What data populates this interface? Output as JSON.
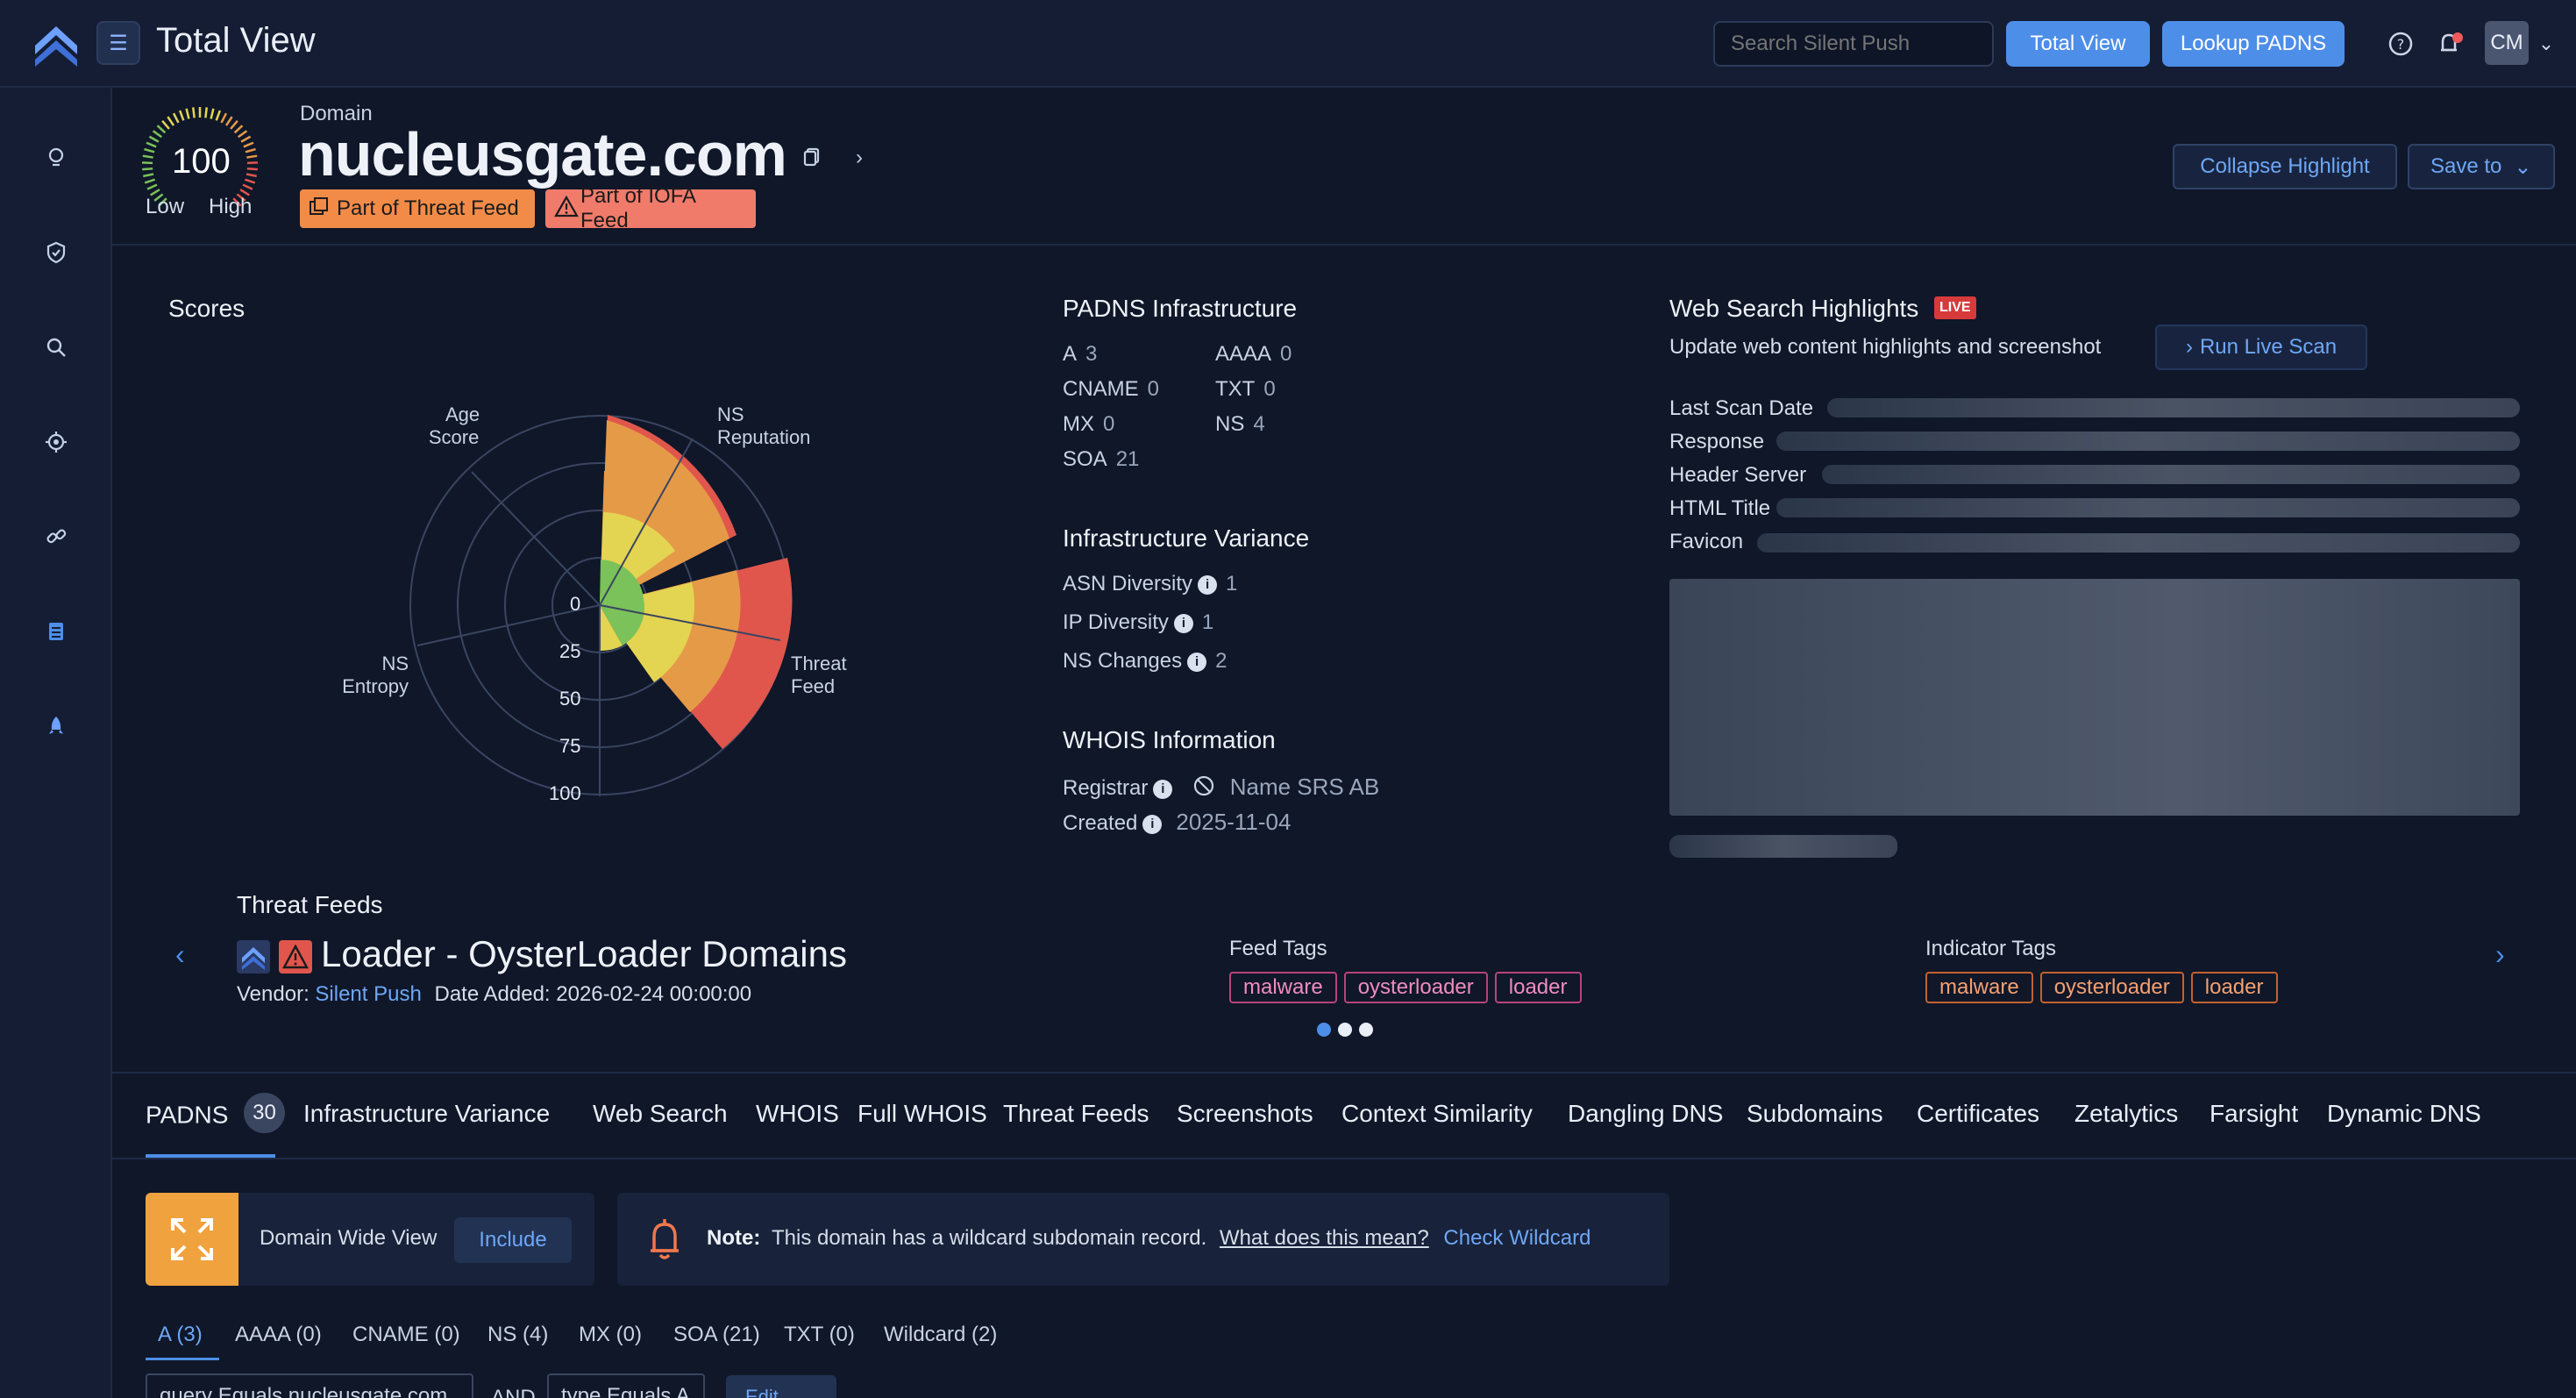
{
  "topbar": {
    "title": "Total View",
    "search_placeholder": "Search Silent Push",
    "total_view_label": "Total View",
    "lookup_label": "Lookup PADNS",
    "avatar_initials": "CM"
  },
  "header": {
    "score": "100",
    "gauge_low": "Low",
    "gauge_high": "High",
    "domain_label": "Domain",
    "domain": "nucleusgate.com",
    "badge_threat_feed": "Part of Threat Feed",
    "badge_iofa": "Part of IOFA Feed",
    "collapse_label": "Collapse Highlight",
    "save_label": "Save to"
  },
  "scores": {
    "title": "Scores",
    "axis_labels": {
      "age_line1": "Age",
      "age_line2": "Score",
      "ns_rep_line1": "NS",
      "ns_rep_line2": "Reputation",
      "ns_ent_line1": "NS",
      "ns_ent_line2": "Entropy",
      "threat_line1": "Threat",
      "threat_line2": "Feed"
    },
    "ticks": [
      "0",
      "25",
      "50",
      "75",
      "100"
    ]
  },
  "padns": {
    "title": "PADNS Infrastructure",
    "a_label": "A",
    "a_value": "3",
    "aaaa_label": "AAAA",
    "aaaa_value": "0",
    "cname_label": "CNAME",
    "cname_value": "0",
    "txt_label": "TXT",
    "txt_value": "0",
    "mx_label": "MX",
    "mx_value": "0",
    "ns_label": "NS",
    "ns_value": "4",
    "soa_label": "SOA",
    "soa_value": "21"
  },
  "variance": {
    "title": "Infrastructure Variance",
    "asn_label": "ASN Diversity",
    "asn_value": "1",
    "ip_label": "IP Diversity",
    "ip_value": "1",
    "ns_label": "NS Changes",
    "ns_value": "2"
  },
  "whois": {
    "title": "WHOIS Information",
    "registrar_label": "Registrar",
    "registrar_value": "Name SRS AB",
    "created_label": "Created",
    "created_value": "2025-11-04"
  },
  "websearch": {
    "title": "Web Search Highlights",
    "live": "LIVE",
    "subtitle": "Update web content highlights and screenshot",
    "run_label": "Run Live Scan",
    "fields": [
      "Last Scan Date",
      "Response",
      "Header Server",
      "HTML Title",
      "Favicon"
    ]
  },
  "threat_feeds": {
    "title": "Threat Feeds",
    "feed_name": "Loader - OysterLoader Domains",
    "vendor_label": "Vendor:",
    "vendor": "Silent Push",
    "date_label": "Date Added:",
    "date": "2026-02-24 00:00:00",
    "feed_tags_title": "Feed Tags",
    "feed_tags": [
      "malware",
      "oysterloader",
      "loader"
    ],
    "indicator_tags_title": "Indicator Tags",
    "indicator_tags": [
      "malware",
      "oysterloader",
      "loader"
    ]
  },
  "tabs": {
    "padns": "PADNS",
    "padns_count": "30",
    "items": [
      "Infrastructure Variance",
      "Web Search",
      "WHOIS",
      "Full WHOIS",
      "Threat Feeds",
      "Screenshots",
      "Context Similarity",
      "Dangling DNS",
      "Subdomains",
      "Certificates",
      "Zetalytics",
      "Farsight",
      "Dynamic DNS"
    ]
  },
  "domain_view": {
    "label": "Domain Wide View",
    "include": "Include"
  },
  "note": {
    "prefix": "Note:",
    "text": "This domain has a wildcard subdomain record.",
    "link": "What does this mean?",
    "check": "Check Wildcard"
  },
  "record_tabs": [
    "A (3)",
    "AAAA (0)",
    "CNAME (0)",
    "NS (4)",
    "MX (0)",
    "SOA (21)",
    "TXT (0)",
    "Wildcard (2)"
  ],
  "filter": {
    "query1": "query Equals nucleusgate.com",
    "and": "AND",
    "query2": "type Equals A",
    "edit": "Edit"
  }
}
